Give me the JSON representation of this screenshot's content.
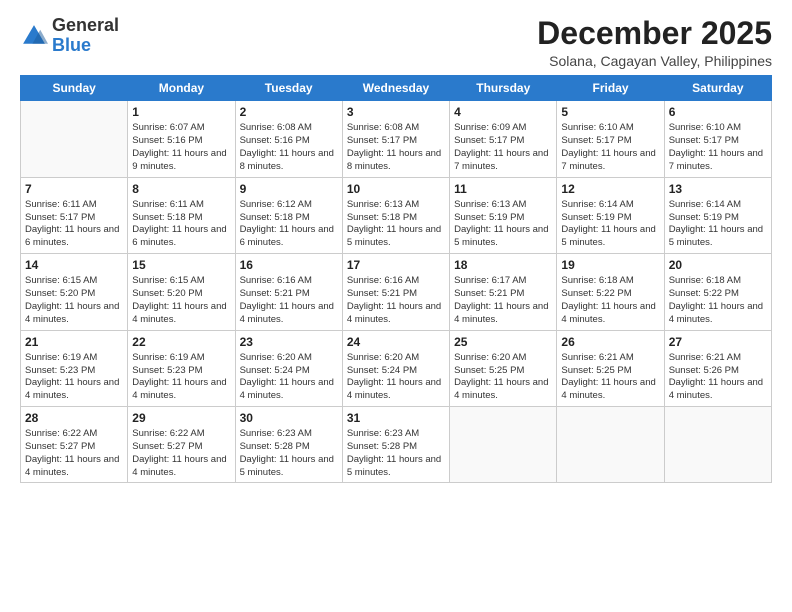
{
  "logo": {
    "general": "General",
    "blue": "Blue"
  },
  "header": {
    "month": "December 2025",
    "location": "Solana, Cagayan Valley, Philippines"
  },
  "days": [
    "Sunday",
    "Monday",
    "Tuesday",
    "Wednesday",
    "Thursday",
    "Friday",
    "Saturday"
  ],
  "weeks": [
    [
      {
        "day": "",
        "content": ""
      },
      {
        "day": "1",
        "sunrise": "6:07 AM",
        "sunset": "5:16 PM",
        "daylight": "11 hours and 9 minutes."
      },
      {
        "day": "2",
        "sunrise": "6:08 AM",
        "sunset": "5:16 PM",
        "daylight": "11 hours and 8 minutes."
      },
      {
        "day": "3",
        "sunrise": "6:08 AM",
        "sunset": "5:17 PM",
        "daylight": "11 hours and 8 minutes."
      },
      {
        "day": "4",
        "sunrise": "6:09 AM",
        "sunset": "5:17 PM",
        "daylight": "11 hours and 7 minutes."
      },
      {
        "day": "5",
        "sunrise": "6:10 AM",
        "sunset": "5:17 PM",
        "daylight": "11 hours and 7 minutes."
      },
      {
        "day": "6",
        "sunrise": "6:10 AM",
        "sunset": "5:17 PM",
        "daylight": "11 hours and 7 minutes."
      }
    ],
    [
      {
        "day": "7",
        "sunrise": "6:11 AM",
        "sunset": "5:17 PM",
        "daylight": "11 hours and 6 minutes."
      },
      {
        "day": "8",
        "sunrise": "6:11 AM",
        "sunset": "5:18 PM",
        "daylight": "11 hours and 6 minutes."
      },
      {
        "day": "9",
        "sunrise": "6:12 AM",
        "sunset": "5:18 PM",
        "daylight": "11 hours and 6 minutes."
      },
      {
        "day": "10",
        "sunrise": "6:13 AM",
        "sunset": "5:18 PM",
        "daylight": "11 hours and 5 minutes."
      },
      {
        "day": "11",
        "sunrise": "6:13 AM",
        "sunset": "5:19 PM",
        "daylight": "11 hours and 5 minutes."
      },
      {
        "day": "12",
        "sunrise": "6:14 AM",
        "sunset": "5:19 PM",
        "daylight": "11 hours and 5 minutes."
      },
      {
        "day": "13",
        "sunrise": "6:14 AM",
        "sunset": "5:19 PM",
        "daylight": "11 hours and 5 minutes."
      }
    ],
    [
      {
        "day": "14",
        "sunrise": "6:15 AM",
        "sunset": "5:20 PM",
        "daylight": "11 hours and 4 minutes."
      },
      {
        "day": "15",
        "sunrise": "6:15 AM",
        "sunset": "5:20 PM",
        "daylight": "11 hours and 4 minutes."
      },
      {
        "day": "16",
        "sunrise": "6:16 AM",
        "sunset": "5:21 PM",
        "daylight": "11 hours and 4 minutes."
      },
      {
        "day": "17",
        "sunrise": "6:16 AM",
        "sunset": "5:21 PM",
        "daylight": "11 hours and 4 minutes."
      },
      {
        "day": "18",
        "sunrise": "6:17 AM",
        "sunset": "5:21 PM",
        "daylight": "11 hours and 4 minutes."
      },
      {
        "day": "19",
        "sunrise": "6:18 AM",
        "sunset": "5:22 PM",
        "daylight": "11 hours and 4 minutes."
      },
      {
        "day": "20",
        "sunrise": "6:18 AM",
        "sunset": "5:22 PM",
        "daylight": "11 hours and 4 minutes."
      }
    ],
    [
      {
        "day": "21",
        "sunrise": "6:19 AM",
        "sunset": "5:23 PM",
        "daylight": "11 hours and 4 minutes."
      },
      {
        "day": "22",
        "sunrise": "6:19 AM",
        "sunset": "5:23 PM",
        "daylight": "11 hours and 4 minutes."
      },
      {
        "day": "23",
        "sunrise": "6:20 AM",
        "sunset": "5:24 PM",
        "daylight": "11 hours and 4 minutes."
      },
      {
        "day": "24",
        "sunrise": "6:20 AM",
        "sunset": "5:24 PM",
        "daylight": "11 hours and 4 minutes."
      },
      {
        "day": "25",
        "sunrise": "6:20 AM",
        "sunset": "5:25 PM",
        "daylight": "11 hours and 4 minutes."
      },
      {
        "day": "26",
        "sunrise": "6:21 AM",
        "sunset": "5:25 PM",
        "daylight": "11 hours and 4 minutes."
      },
      {
        "day": "27",
        "sunrise": "6:21 AM",
        "sunset": "5:26 PM",
        "daylight": "11 hours and 4 minutes."
      }
    ],
    [
      {
        "day": "28",
        "sunrise": "6:22 AM",
        "sunset": "5:27 PM",
        "daylight": "11 hours and 4 minutes."
      },
      {
        "day": "29",
        "sunrise": "6:22 AM",
        "sunset": "5:27 PM",
        "daylight": "11 hours and 4 minutes."
      },
      {
        "day": "30",
        "sunrise": "6:23 AM",
        "sunset": "5:28 PM",
        "daylight": "11 hours and 5 minutes."
      },
      {
        "day": "31",
        "sunrise": "6:23 AM",
        "sunset": "5:28 PM",
        "daylight": "11 hours and 5 minutes."
      },
      {
        "day": "",
        "content": ""
      },
      {
        "day": "",
        "content": ""
      },
      {
        "day": "",
        "content": ""
      }
    ]
  ],
  "labels": {
    "sunrise": "Sunrise:",
    "sunset": "Sunset:",
    "daylight": "Daylight:"
  }
}
